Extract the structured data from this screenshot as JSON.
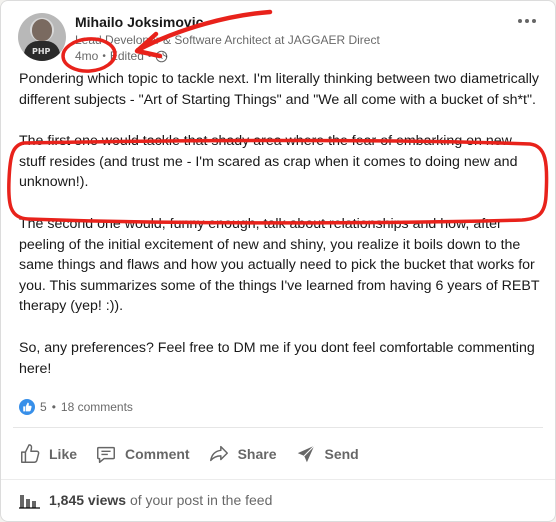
{
  "author": {
    "name": "Mihailo Joksimovic",
    "title": "Lead Developer & Software Architect at JAGGAER Direct",
    "shirt_text": "PHP"
  },
  "meta": {
    "time": "4mo",
    "separator": "•",
    "edited": "Edited",
    "visibility_icon": "globe-icon"
  },
  "post": {
    "paragraphs": [
      "Pondering which topic to tackle next. I'm literally thinking between two diametrically different subjects - \"Art of Starting Things\" and \"We all come with a bucket of sh*t\".",
      "The first one would tackle that shady area where the fear of embarking on new stuff resides (and trust me - I'm scared as crap when it comes to doing new and unknown!).",
      "The second one would, funny enough, talk about relationships and how, after peeling of the initial excitement of new and shiny, you realize it boils down to the same things and flaws and how you actually need to pick the bucket that works for you. This summarizes some of the things I've learned from having 6 years of REBT therapy (yep! :)).",
      "So, any preferences? Feel free to DM me if you dont feel comfortable commenting here!"
    ]
  },
  "social": {
    "reaction_count": "5",
    "separator": "•",
    "comments": "18 comments"
  },
  "actions": {
    "like": "Like",
    "comment": "Comment",
    "share": "Share",
    "send": "Send"
  },
  "views": {
    "count": "1,845 views",
    "suffix": "of your post in the feed"
  },
  "colors": {
    "annotation": "#e8221b",
    "like_blue": "#378fe9"
  }
}
